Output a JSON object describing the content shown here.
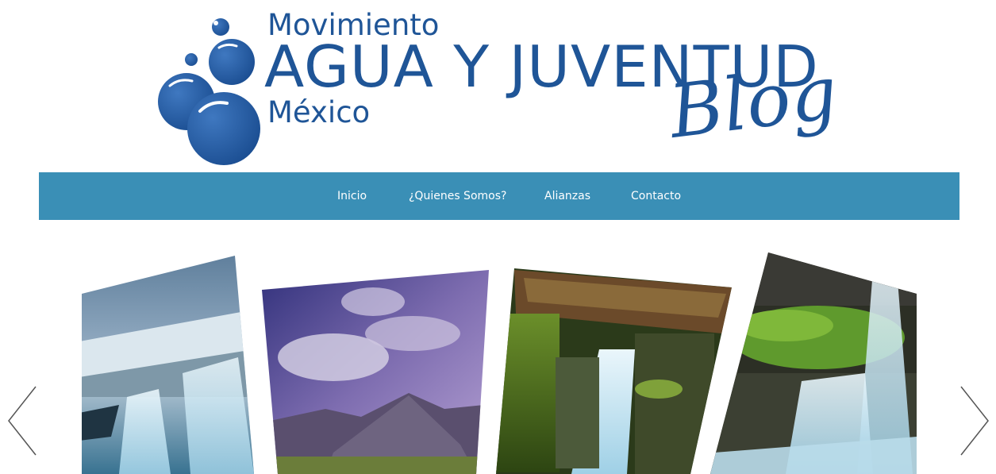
{
  "logo": {
    "line1": "Movimiento",
    "line2": "AGUA Y JUVENTUD",
    "line3": "México",
    "tag": "Blog",
    "color": "#1f5597"
  },
  "nav": {
    "background": "#3a8fb6",
    "items": [
      {
        "label": "Inicio"
      },
      {
        "label": "¿Quienes Somos?"
      },
      {
        "label": "Alianzas"
      },
      {
        "label": "Contacto"
      }
    ]
  },
  "slider": {
    "prev_icon": "chevron-left-icon",
    "next_icon": "chevron-right-icon",
    "slides": [
      {
        "subject": "icy waterfall"
      },
      {
        "subject": "purple sky over mountains"
      },
      {
        "subject": "mossy waterfall under log"
      },
      {
        "subject": "green forest waterfall"
      }
    ]
  }
}
